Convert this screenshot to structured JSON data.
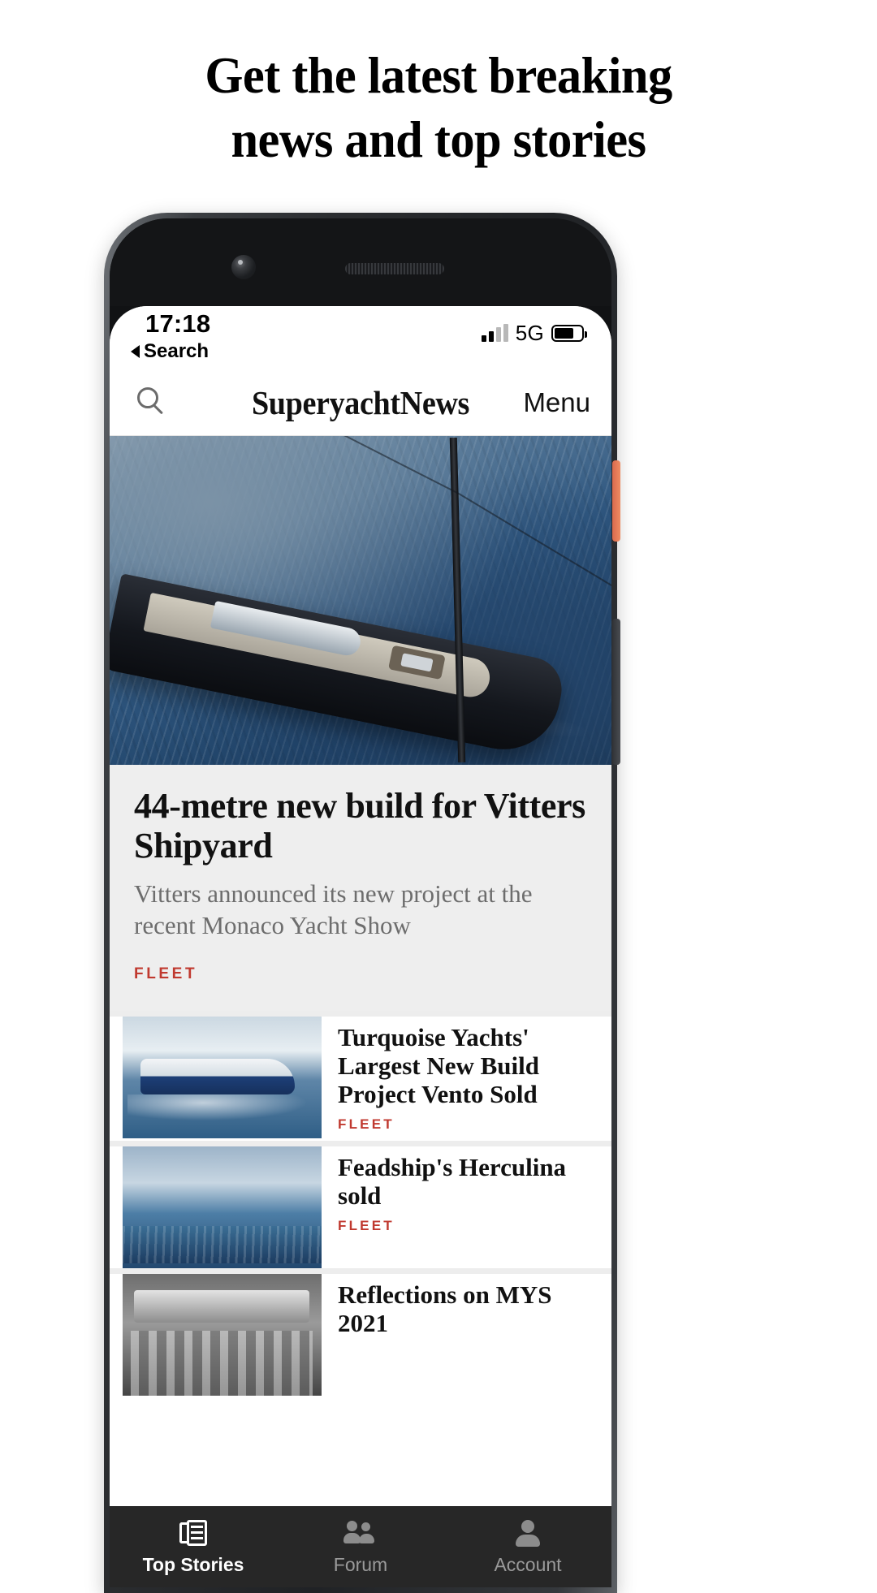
{
  "promo": {
    "line1": "Get the latest breaking",
    "line2": "news and top stories"
  },
  "status_bar": {
    "time": "17:18",
    "back_label": "Search",
    "network": "5G",
    "signal_icon": "signal-bars-icon",
    "battery_icon": "battery-icon"
  },
  "app_header": {
    "search_icon": "search-icon",
    "brand": "SuperyachtNews",
    "menu_label": "Menu"
  },
  "hero": {
    "image_alt": "aerial-view-of-dark-hulled-sailing-superyacht",
    "title": "44-metre new build for Vitters Shipyard",
    "subtitle": "Vitters announced its new project at the recent Monaco Yacht Show",
    "category": "FLEET"
  },
  "articles": [
    {
      "thumb_alt": "blue-hulled-motor-yacht-underway",
      "title": "Turquoise Yachts' Largest New Build Project Vento Sold",
      "category": "FLEET"
    },
    {
      "thumb_alt": "navy-hulled-classic-feadship-at-sea",
      "title": "Feadship's Herculina sold",
      "category": "FLEET"
    },
    {
      "thumb_alt": "black-and-white-people-on-yacht-deck",
      "title": "Reflections on MYS 2021",
      "category": ""
    }
  ],
  "tabbar": {
    "items": [
      {
        "label": "Top Stories",
        "icon": "news-icon",
        "active": true
      },
      {
        "label": "Forum",
        "icon": "people-icon",
        "active": false
      },
      {
        "label": "Account",
        "icon": "person-icon",
        "active": false
      }
    ]
  },
  "colors": {
    "accent_red": "#c0392f",
    "tabbar_bg": "#272727",
    "hero_bg": "#eeeeee"
  }
}
